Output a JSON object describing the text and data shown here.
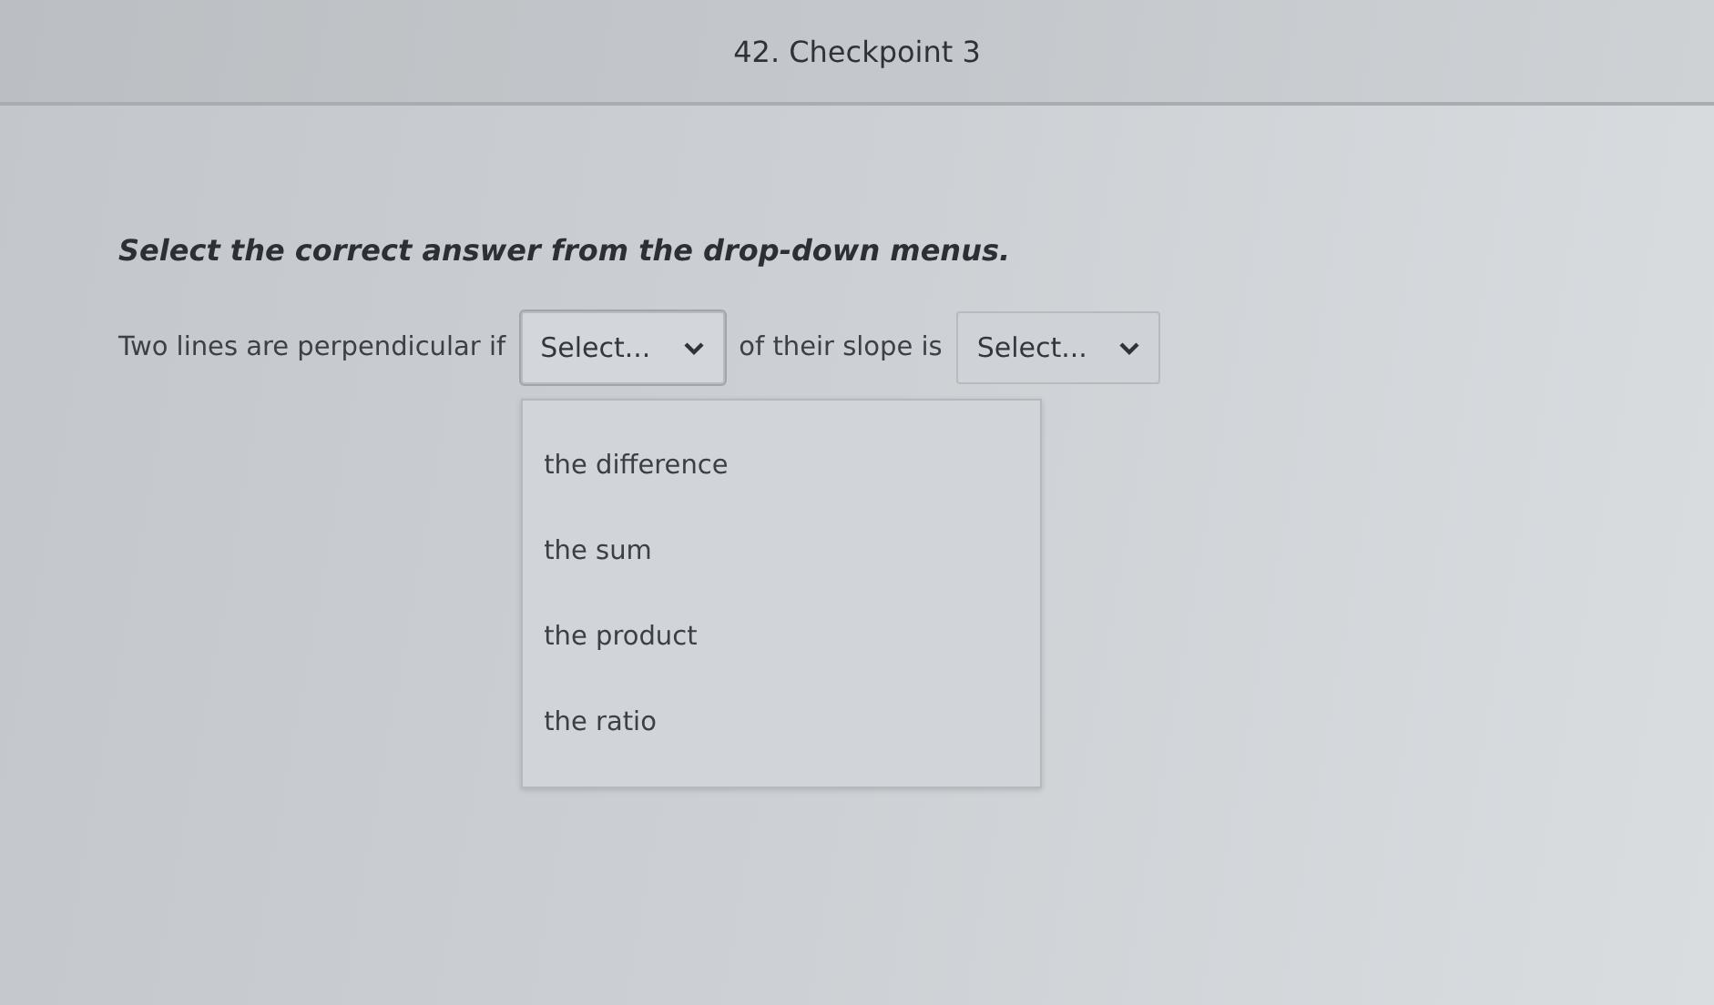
{
  "header": {
    "title": "42. Checkpoint 3"
  },
  "instruction": "Select the correct answer from the drop-down menus.",
  "sentence": [
    {
      "kind": "text",
      "text": "Two lines are perpendicular if"
    },
    {
      "kind": "select",
      "value": "Select...",
      "expanded": true,
      "options": [
        {
          "label": "the difference",
          "selected": false
        },
        {
          "label": "the sum",
          "selected": false
        },
        {
          "label": "the product",
          "selected": false
        },
        {
          "label": "the ratio",
          "selected": false
        }
      ]
    },
    {
      "kind": "text",
      "text": "of their slope is"
    },
    {
      "kind": "select",
      "value": "Select...",
      "expanded": false
    }
  ]
}
